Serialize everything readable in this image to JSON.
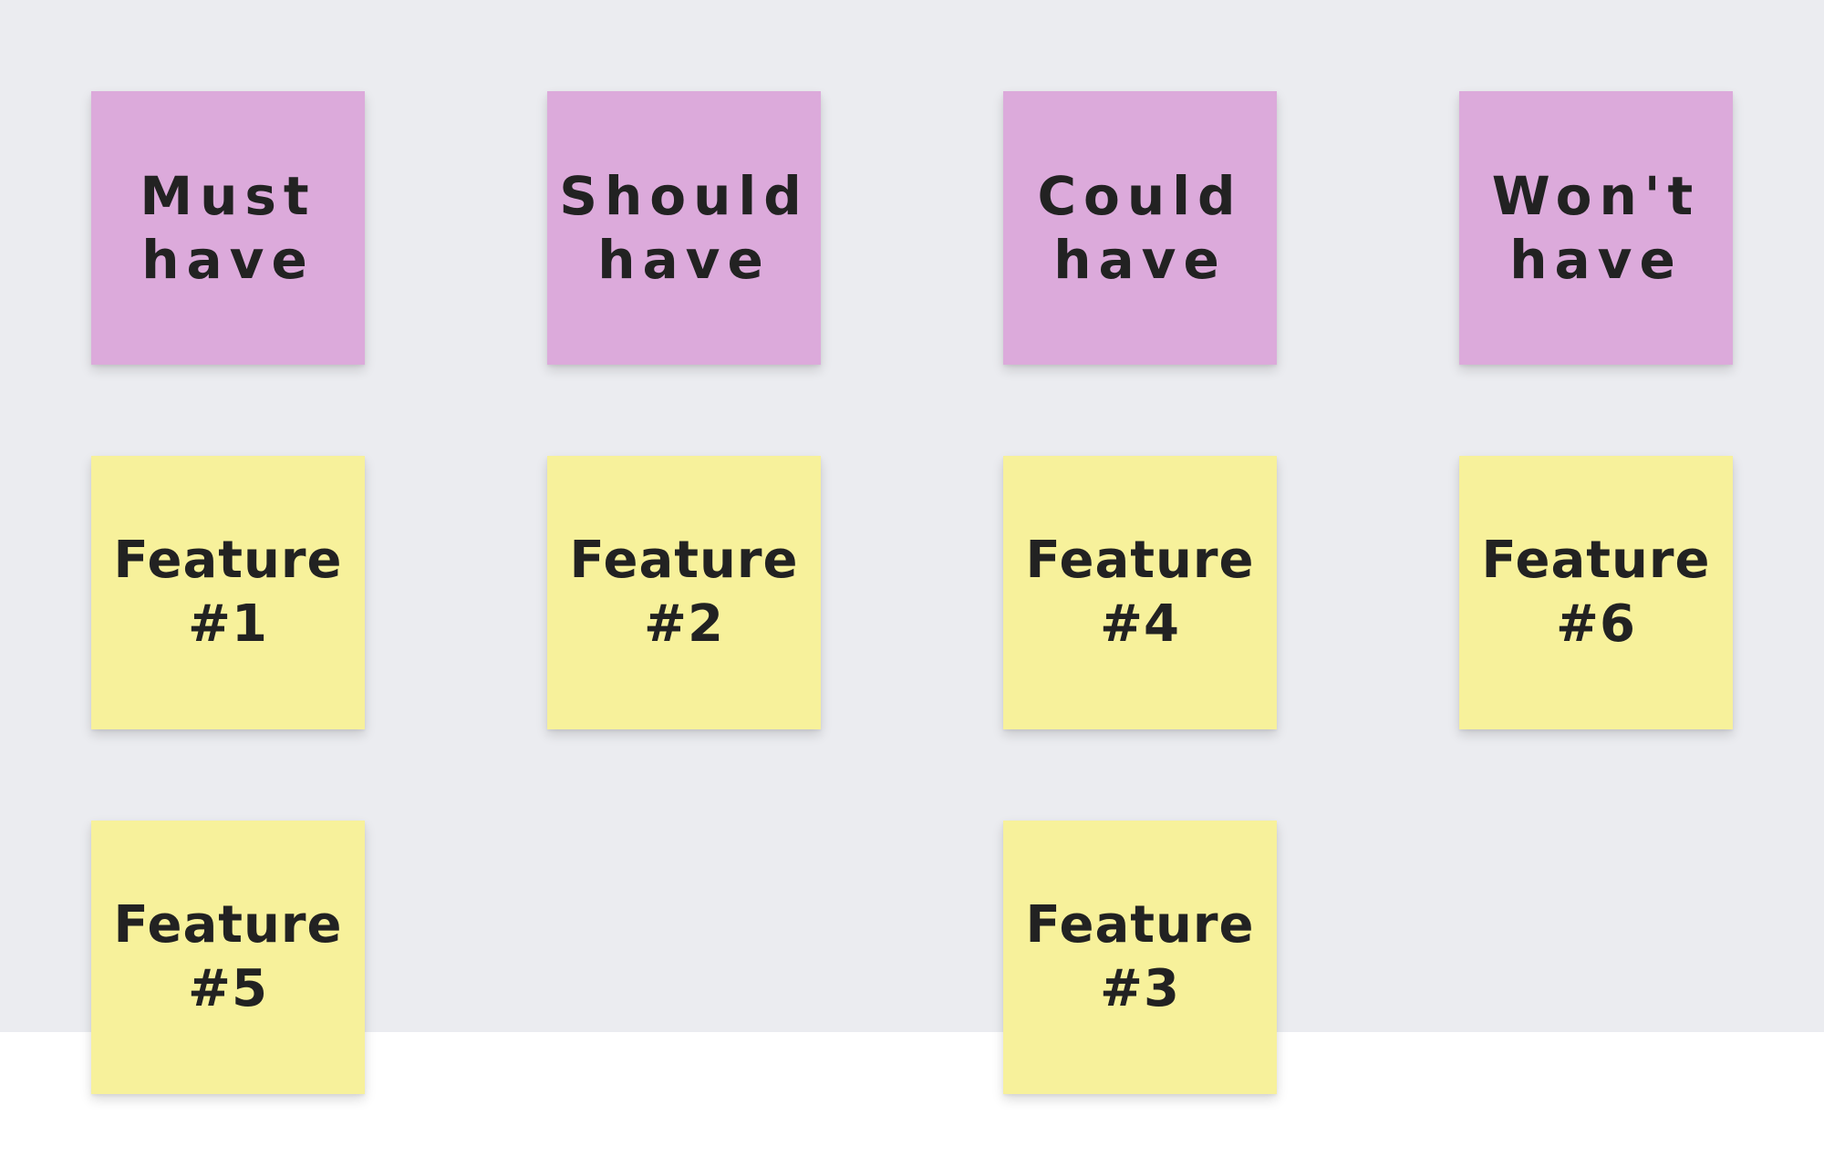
{
  "colors": {
    "background": "#ebecf0",
    "header_note": "#dcaadb",
    "feature_note": "#f7f19b",
    "text": "#222222"
  },
  "headers": [
    {
      "text": "Must\nhave"
    },
    {
      "text": "Should\nhave"
    },
    {
      "text": "Could\nhave"
    },
    {
      "text": "Won't\nhave"
    }
  ],
  "features": [
    {
      "text": "Feature\n#1",
      "column": "Must have"
    },
    {
      "text": "Feature\n#2",
      "column": "Should have"
    },
    {
      "text": "Feature\n#4",
      "column": "Could have"
    },
    {
      "text": "Feature\n#6",
      "column": "Won't have"
    },
    {
      "text": "Feature\n#5",
      "column": "Must have"
    },
    {
      "text": "Feature\n#3",
      "column": "Could have"
    }
  ]
}
